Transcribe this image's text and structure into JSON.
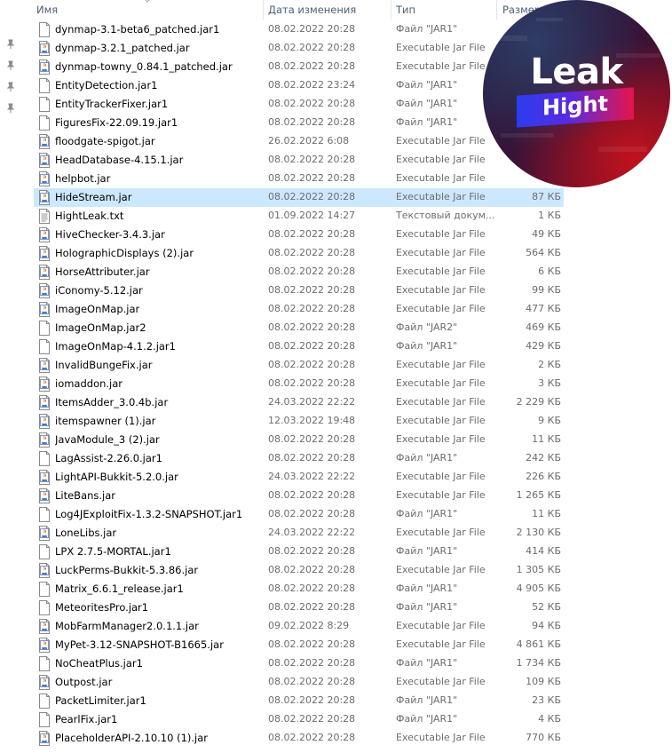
{
  "columns": {
    "name": "Имя",
    "date": "Дата изменения",
    "type": "Тип",
    "size": "Размер"
  },
  "badge": {
    "title": "Leak",
    "subtitle": "Hight"
  },
  "files": [
    {
      "name": "dynmap-3.1-beta6_patched.jar1",
      "date": "08.02.2022 20:28",
      "type": "Файл \"JAR1\"",
      "size": "",
      "icon": "blank-file-icon"
    },
    {
      "name": "dynmap-3.2.1_patched.jar",
      "date": "08.02.2022 20:28",
      "type": "Executable Jar File",
      "size": "",
      "icon": "java-file-icon"
    },
    {
      "name": "dynmap-towny_0.84.1_patched.jar",
      "date": "08.02.2022 20:28",
      "type": "Executable Jar File",
      "size": "",
      "icon": "java-file-icon"
    },
    {
      "name": "EntityDetection.jar1",
      "date": "08.02.2022 23:24",
      "type": "Файл \"JAR1\"",
      "size": "",
      "icon": "blank-file-icon"
    },
    {
      "name": "EntityTrackerFixer.jar1",
      "date": "08.02.2022 20:28",
      "type": "Файл \"JAR1\"",
      "size": "",
      "icon": "blank-file-icon"
    },
    {
      "name": "FiguresFix-22.09.19.jar1",
      "date": "08.02.2022 20:28",
      "type": "Файл \"JAR1\"",
      "size": "",
      "icon": "blank-file-icon"
    },
    {
      "name": "floodgate-spigot.jar",
      "date": "26.02.2022 6:08",
      "type": "Executable Jar File",
      "size": "",
      "icon": "java-file-icon"
    },
    {
      "name": "HeadDatabase-4.15.1.jar",
      "date": "08.02.2022 20:28",
      "type": "Executable Jar File",
      "size": "",
      "icon": "java-file-icon"
    },
    {
      "name": "helpbot.jar",
      "date": "08.02.2022 20:28",
      "type": "Executable Jar File",
      "size": "",
      "icon": "java-file-icon"
    },
    {
      "name": "HideStream.jar",
      "date": "08.02.2022 20:28",
      "type": "Executable Jar File",
      "size": "87 КБ",
      "icon": "java-file-icon",
      "selected": true
    },
    {
      "name": "HightLeak.txt",
      "date": "01.09.2022 14:27",
      "type": "Текстовый докум...",
      "size": "1 КБ",
      "icon": "text-file-icon"
    },
    {
      "name": "HiveChecker-3.4.3.jar",
      "date": "08.02.2022 20:28",
      "type": "Executable Jar File",
      "size": "49 КБ",
      "icon": "java-file-icon"
    },
    {
      "name": "HolographicDisplays (2).jar",
      "date": "08.02.2022 20:28",
      "type": "Executable Jar File",
      "size": "564 КБ",
      "icon": "java-file-icon"
    },
    {
      "name": "HorseAttributer.jar",
      "date": "08.02.2022 20:28",
      "type": "Executable Jar File",
      "size": "6 КБ",
      "icon": "java-file-icon"
    },
    {
      "name": "iConomy-5.12.jar",
      "date": "08.02.2022 20:28",
      "type": "Executable Jar File",
      "size": "99 КБ",
      "icon": "java-file-icon"
    },
    {
      "name": "ImageOnMap.jar",
      "date": "08.02.2022 20:28",
      "type": "Executable Jar File",
      "size": "477 КБ",
      "icon": "java-file-icon"
    },
    {
      "name": "ImageOnMap.jar2",
      "date": "08.02.2022 20:28",
      "type": "Файл \"JAR2\"",
      "size": "469 КБ",
      "icon": "blank-file-icon"
    },
    {
      "name": "ImageOnMap-4.1.2.jar1",
      "date": "08.02.2022 20:28",
      "type": "Файл \"JAR1\"",
      "size": "429 КБ",
      "icon": "blank-file-icon"
    },
    {
      "name": "InvalidBungeFix.jar",
      "date": "08.02.2022 20:28",
      "type": "Executable Jar File",
      "size": "2 КБ",
      "icon": "java-file-icon"
    },
    {
      "name": "iomaddon.jar",
      "date": "08.02.2022 20:28",
      "type": "Executable Jar File",
      "size": "3 КБ",
      "icon": "java-file-icon"
    },
    {
      "name": "ItemsAdder_3.0.4b.jar",
      "date": "24.03.2022 22:22",
      "type": "Executable Jar File",
      "size": "2 229 КБ",
      "icon": "java-file-icon"
    },
    {
      "name": "itemspawner (1).jar",
      "date": "12.03.2022 19:48",
      "type": "Executable Jar File",
      "size": "9 КБ",
      "icon": "java-file-icon"
    },
    {
      "name": "JavaModule_3 (2).jar",
      "date": "08.02.2022 20:28",
      "type": "Executable Jar File",
      "size": "11 КБ",
      "icon": "java-file-icon"
    },
    {
      "name": "LagAssist-2.26.0.jar1",
      "date": "08.02.2022 20:28",
      "type": "Файл \"JAR1\"",
      "size": "242 КБ",
      "icon": "blank-file-icon"
    },
    {
      "name": "LightAPI-Bukkit-5.2.0.jar",
      "date": "24.03.2022 22:22",
      "type": "Executable Jar File",
      "size": "226 КБ",
      "icon": "java-file-icon"
    },
    {
      "name": "LiteBans.jar",
      "date": "08.02.2022 20:28",
      "type": "Executable Jar File",
      "size": "1 265 КБ",
      "icon": "java-file-icon"
    },
    {
      "name": "Log4JExploitFix-1.3.2-SNAPSHOT.jar1",
      "date": "08.02.2022 20:28",
      "type": "Файл \"JAR1\"",
      "size": "11 КБ",
      "icon": "blank-file-icon"
    },
    {
      "name": "LoneLibs.jar",
      "date": "24.03.2022 22:22",
      "type": "Executable Jar File",
      "size": "2 130 КБ",
      "icon": "java-file-icon"
    },
    {
      "name": "LPX 2.7.5-MORTAL.jar1",
      "date": "08.02.2022 20:28",
      "type": "Файл \"JAR1\"",
      "size": "414 КБ",
      "icon": "blank-file-icon"
    },
    {
      "name": "LuckPerms-Bukkit-5.3.86.jar",
      "date": "08.02.2022 20:28",
      "type": "Executable Jar File",
      "size": "1 305 КБ",
      "icon": "java-file-icon"
    },
    {
      "name": "Matrix_6.6.1_release.jar1",
      "date": "08.02.2022 20:28",
      "type": "Файл \"JAR1\"",
      "size": "4 905 КБ",
      "icon": "blank-file-icon"
    },
    {
      "name": "MeteoritesPro.jar1",
      "date": "08.02.2022 20:28",
      "type": "Файл \"JAR1\"",
      "size": "52 КБ",
      "icon": "blank-file-icon"
    },
    {
      "name": "MobFarmManager2.0.1.1.jar",
      "date": "09.02.2022 8:29",
      "type": "Executable Jar File",
      "size": "94 КБ",
      "icon": "java-file-icon"
    },
    {
      "name": "MyPet-3.12-SNAPSHOT-B1665.jar",
      "date": "08.02.2022 20:28",
      "type": "Executable Jar File",
      "size": "4 861 КБ",
      "icon": "java-file-icon"
    },
    {
      "name": "NoCheatPlus.jar1",
      "date": "08.02.2022 20:28",
      "type": "Файл \"JAR1\"",
      "size": "1 734 КБ",
      "icon": "blank-file-icon"
    },
    {
      "name": "Outpost.jar",
      "date": "08.02.2022 20:28",
      "type": "Executable Jar File",
      "size": "109 КБ",
      "icon": "java-file-icon"
    },
    {
      "name": "PacketLimiter.jar1",
      "date": "08.02.2022 20:28",
      "type": "Файл \"JAR1\"",
      "size": "23 КБ",
      "icon": "blank-file-icon"
    },
    {
      "name": "PearlFix.jar1",
      "date": "08.02.2022 20:28",
      "type": "Файл \"JAR1\"",
      "size": "4 КБ",
      "icon": "blank-file-icon"
    },
    {
      "name": "PlaceholderAPI-2.10.10 (1).jar",
      "date": "08.02.2022 20:28",
      "type": "Executable Jar File",
      "size": "770 КБ",
      "icon": "java-file-icon"
    }
  ]
}
